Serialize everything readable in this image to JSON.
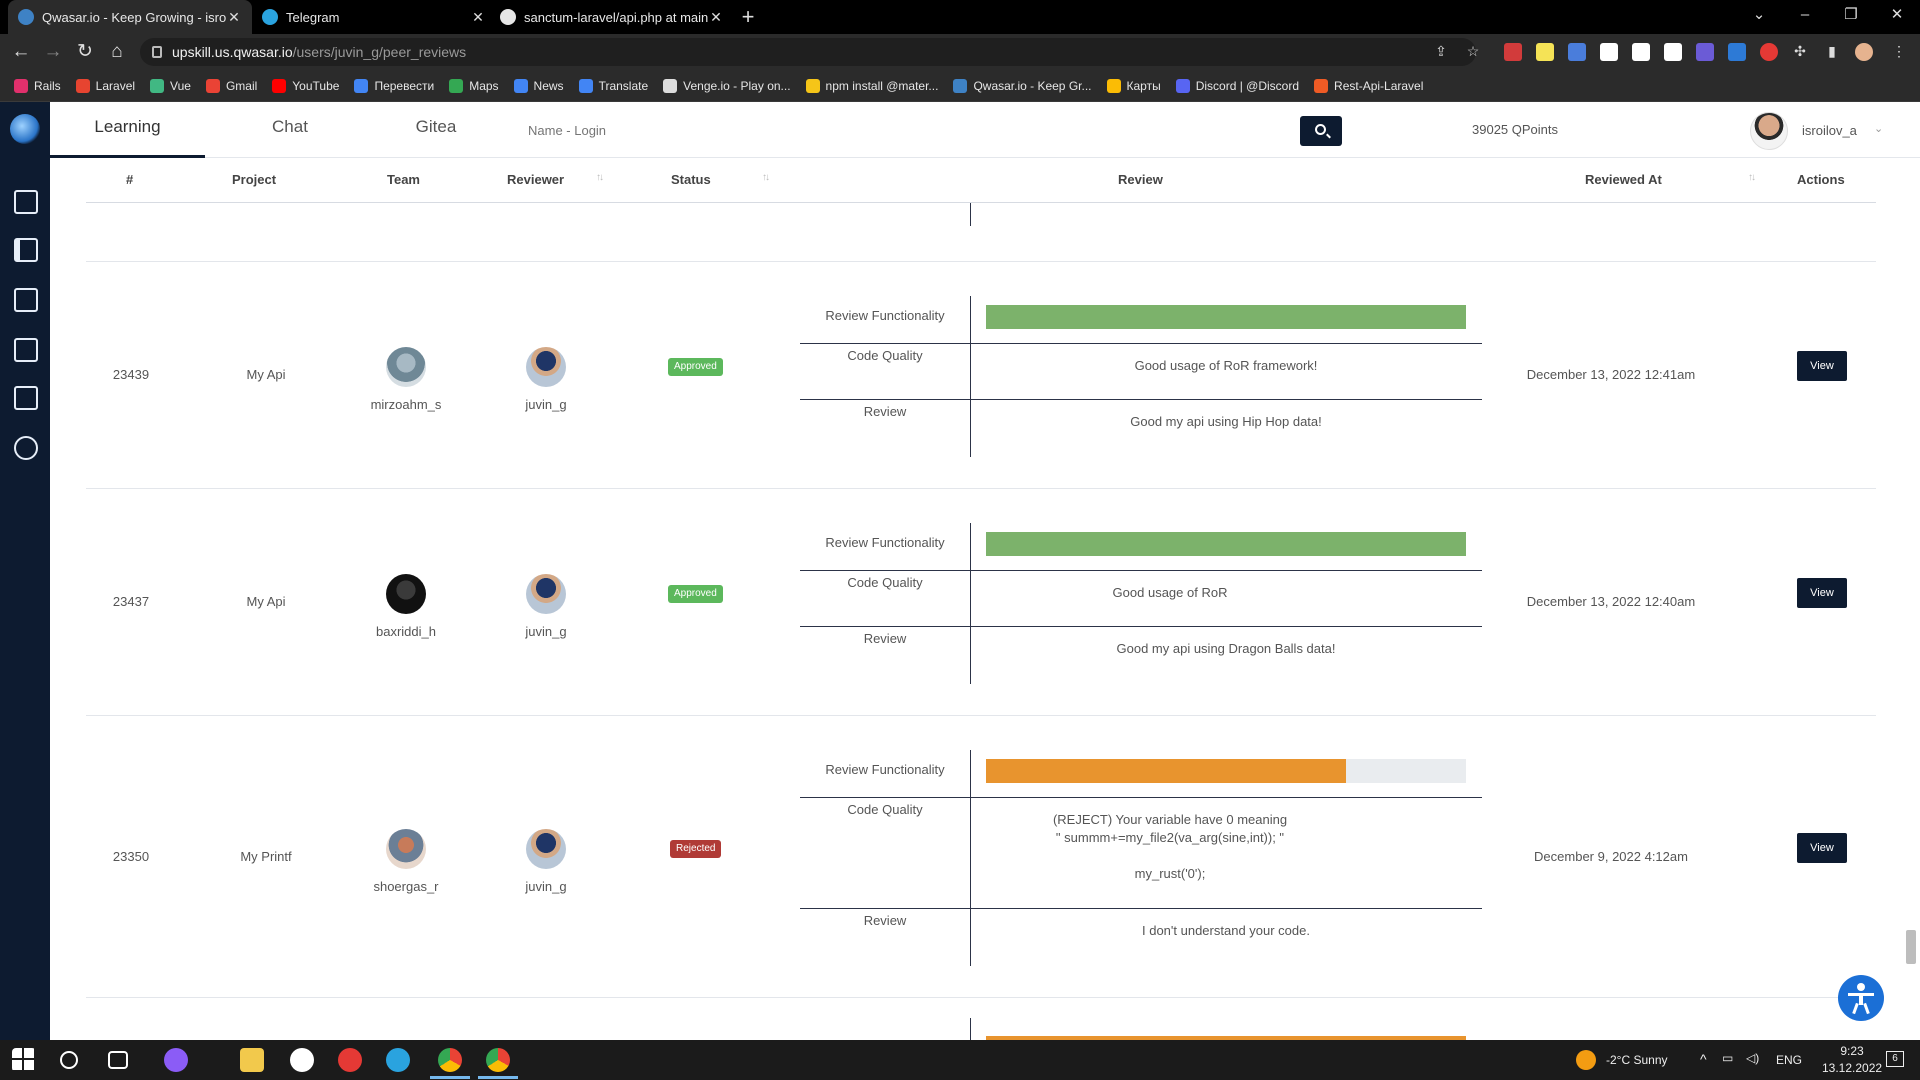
{
  "browser": {
    "tabs": [
      {
        "title": "Qwasar.io - Keep Growing - isroil",
        "color": "#3e82c5",
        "active": true
      },
      {
        "title": "Telegram",
        "color": "#2aa3df",
        "active": false
      },
      {
        "title": "sanctum-laravel/api.php at main",
        "color": "#e6e6e6",
        "active": false
      }
    ],
    "url_host": "upskill.us.qwasar.io",
    "url_path": "/users/juvin_g/peer_reviews",
    "bookmarks": [
      {
        "label": "Rails",
        "color": "#e1306c"
      },
      {
        "label": "Laravel",
        "color": "#e74430"
      },
      {
        "label": "Vue",
        "color": "#41b883"
      },
      {
        "label": "Gmail",
        "color": "#ea4335"
      },
      {
        "label": "YouTube",
        "color": "#ff0000"
      },
      {
        "label": "Перевести",
        "color": "#4285f4"
      },
      {
        "label": "Maps",
        "color": "#34a853"
      },
      {
        "label": "News",
        "color": "#4285f4"
      },
      {
        "label": "Translate",
        "color": "#4285f4"
      },
      {
        "label": "Venge.io - Play on...",
        "color": "#dddddd"
      },
      {
        "label": "npm install @mater...",
        "color": "#f5c518"
      },
      {
        "label": "Qwasar.io - Keep Gr...",
        "color": "#3e82c5"
      },
      {
        "label": "Карты",
        "color": "#fbbc05"
      },
      {
        "label": "Discord | @Discord",
        "color": "#5865f2"
      },
      {
        "label": "Rest-Api-Laravel",
        "color": "#ef5b25"
      }
    ]
  },
  "header": {
    "nav": [
      "Learning",
      "Chat",
      "Gitea"
    ],
    "search_placeholder": "Name - Login",
    "qpoints": "39025 QPoints",
    "username": "isroilov_a"
  },
  "table": {
    "columns": {
      "number": "#",
      "project": "Project",
      "team": "Team",
      "reviewer": "Reviewer",
      "status": "Status",
      "review": "Review",
      "reviewed_at": "Reviewed At",
      "actions": "Actions"
    },
    "review_labels": {
      "functionality": "Review Functionality",
      "code_quality": "Code Quality",
      "review": "Review"
    },
    "rows": [
      {
        "id": "23439",
        "project": "My Api",
        "team": "mirzoahm_s",
        "reviewer": "juvin_g",
        "status": "Approved",
        "functionality_score": 1.0,
        "functionality_color": "#7cb26b",
        "code_quality": "Good usage of RoR framework!",
        "review": "Good my api using Hip Hop data!",
        "reviewed_at": "December 13, 2022 12:41am",
        "action": "View"
      },
      {
        "id": "23437",
        "project": "My Api",
        "team": "baxriddi_h",
        "reviewer": "juvin_g",
        "status": "Approved",
        "functionality_score": 1.0,
        "functionality_color": "#7cb26b",
        "code_quality": "Good usage of RoR",
        "review": "Good my api using Dragon Balls data!",
        "reviewed_at": "December 13, 2022 12:40am",
        "action": "View"
      },
      {
        "id": "23350",
        "project": "My Printf",
        "team": "shoergas_r",
        "reviewer": "juvin_g",
        "status": "Rejected",
        "functionality_score": 0.75,
        "functionality_color": "#e8942e",
        "code_quality_lines": [
          "(REJECT) Your variable have 0 meaning",
          "\" summm+=my_file2(va_arg(sine,int)); \"",
          "",
          "my_rust('0');"
        ],
        "review": "I don't understand your code.",
        "reviewed_at": "December 9, 2022 4:12am",
        "action": "View"
      }
    ]
  },
  "taskbar": {
    "weather": "-2°C  Sunny",
    "lang": "ENG",
    "time": "9:23",
    "date": "13.12.2022",
    "notifications": "6"
  }
}
